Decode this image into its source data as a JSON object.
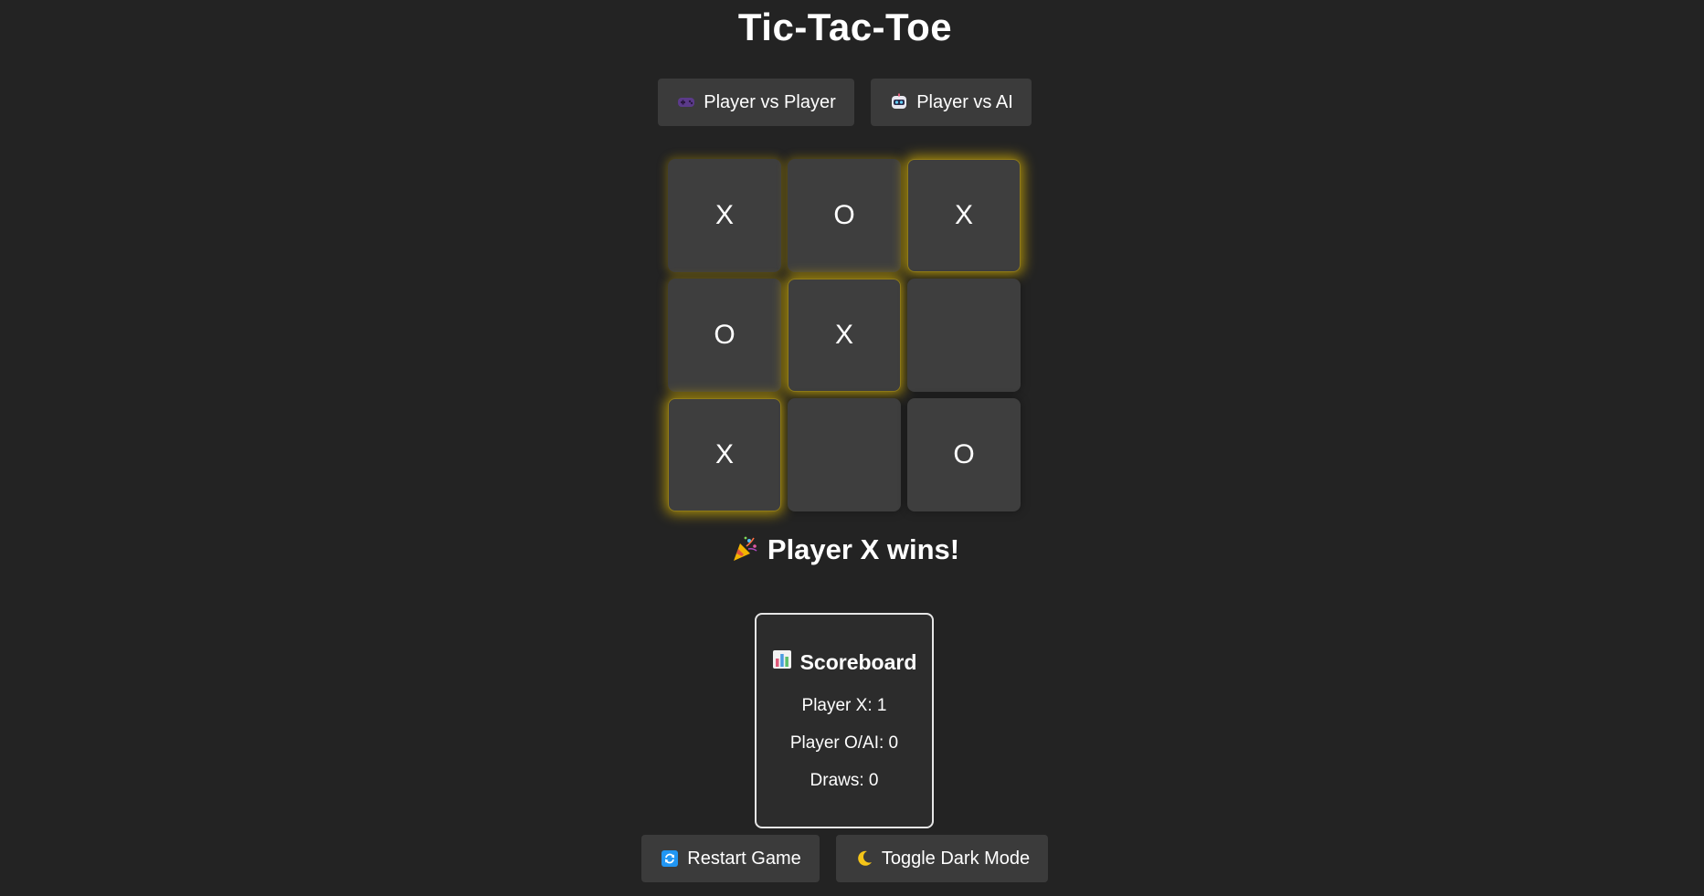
{
  "title": "Tic-Tac-Toe",
  "modes": {
    "pvp_label": "Player vs Player",
    "pvp_icon": "video-game-icon",
    "pvai_label": "Player vs AI",
    "pvai_icon": "robot-icon"
  },
  "board": {
    "cells": [
      "X",
      "O",
      "X",
      "O",
      "X",
      "",
      "X",
      "",
      "O"
    ],
    "winning_line": [
      2,
      4,
      6
    ],
    "win_color": "#d4af00"
  },
  "status": {
    "icon": "party-popper-icon",
    "text": "Player X wins!"
  },
  "scoreboard": {
    "icon": "bar-chart-icon",
    "title": "Scoreboard",
    "player_x": "Player X: 1",
    "player_o": "Player O/AI: 0",
    "draws": "Draws: 0"
  },
  "controls": {
    "restart_label": "Restart Game",
    "restart_icon": "refresh-icon",
    "darkmode_label": "Toggle Dark Mode",
    "darkmode_icon": "crescent-moon-icon"
  },
  "colors": {
    "background": "#232323",
    "button": "#3b3b3b",
    "cell": "#3e3e3e",
    "text": "#ffffff"
  }
}
